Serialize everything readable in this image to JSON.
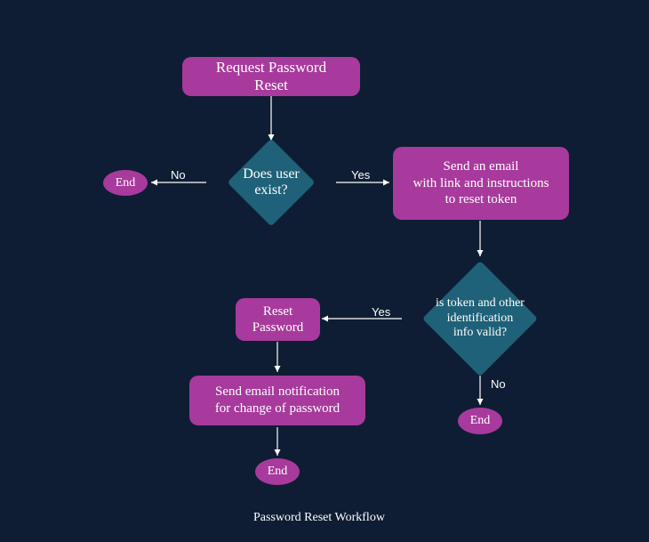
{
  "nodes": {
    "request_reset": "Request Password Reset",
    "user_exist": "Does user\nexist?",
    "end1": "End",
    "send_email": "Send an email\nwith link and instructions\nto reset token",
    "token_valid": "is token and other\nidentification\ninfo valid?",
    "reset_password": "Reset\nPassword",
    "send_notification": "Send email notification\nfor change of password",
    "end2": "End",
    "end3": "End"
  },
  "edges": {
    "no1": "No",
    "yes1": "Yes",
    "yes2": "Yes",
    "no2": "No"
  },
  "caption": "Password Reset Workflow"
}
